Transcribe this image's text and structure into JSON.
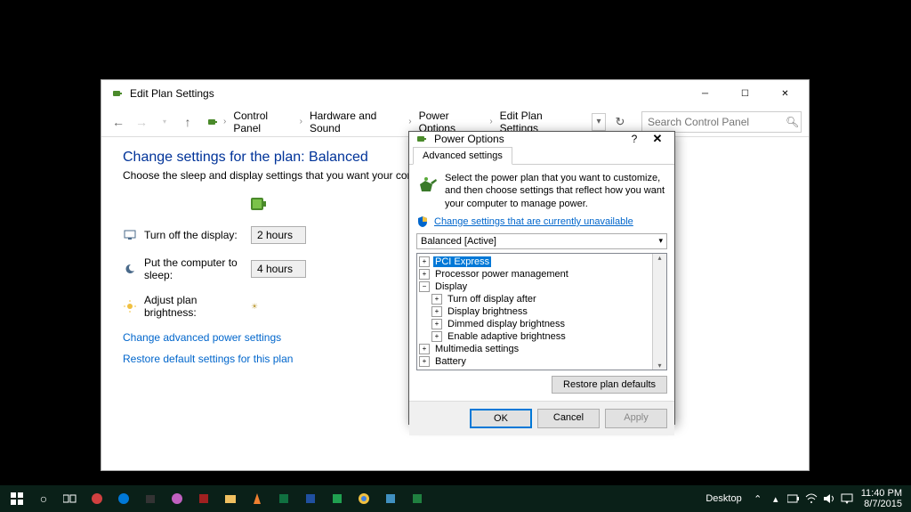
{
  "main_window": {
    "title": "Edit Plan Settings",
    "breadcrumb": [
      "Control Panel",
      "Hardware and Sound",
      "Power Options",
      "Edit Plan Settings"
    ],
    "search_placeholder": "Search Control Panel",
    "heading": "Change settings for the plan: Balanced",
    "sub": "Choose the sleep and display settings that you want your computer to use.",
    "rows": {
      "display_off": {
        "label": "Turn off the display:",
        "value": "2 hours"
      },
      "sleep": {
        "label": "Put the computer to sleep:",
        "value": "4 hours"
      },
      "brightness": {
        "label": "Adjust plan brightness:"
      }
    },
    "links": {
      "advanced": "Change advanced power settings",
      "restore": "Restore default settings for this plan"
    }
  },
  "dialog": {
    "title": "Power Options",
    "tab": "Advanced settings",
    "info": "Select the power plan that you want to customize, and then choose settings that reflect how you want your computer to manage power.",
    "shield_link": "Change settings that are currently unavailable",
    "plan_selected": "Balanced [Active]",
    "tree": {
      "pci": "PCI Express",
      "ppm": "Processor power management",
      "display": "Display",
      "display_children": [
        "Turn off display after",
        "Display brightness",
        "Dimmed display brightness",
        "Enable adaptive brightness"
      ],
      "multimedia": "Multimedia settings",
      "battery": "Battery"
    },
    "buttons": {
      "restore": "Restore plan defaults",
      "ok": "OK",
      "cancel": "Cancel",
      "apply": "Apply"
    }
  },
  "taskbar": {
    "desktop": "Desktop",
    "time": "11:40 PM",
    "date": "8/7/2015"
  }
}
